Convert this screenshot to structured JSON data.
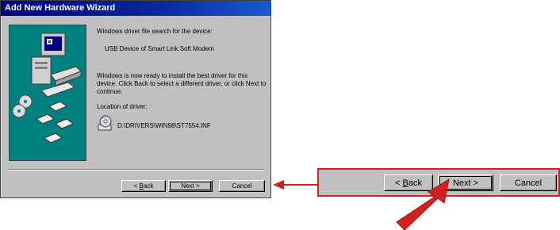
{
  "window": {
    "title": "Add New Hardware Wizard"
  },
  "content": {
    "search_label": "Windows driver file search for the device:",
    "device_name": "USB Device of Smart Link Soft Modem",
    "ready_text": "Windows is now ready to install the best driver for this device. Click Back to select a different driver, or click Next to continue.",
    "location_label": "Location of driver:",
    "driver_path": "D:\\DRIVERS\\WIN98\\ST7554.INF"
  },
  "buttons": {
    "back_prefix": "< ",
    "back_accel": "B",
    "back_rest": "ack",
    "next_label": "Next >",
    "cancel_label": "Cancel"
  },
  "icons": {
    "banner": "computer-with-disks-icon",
    "driver": "cd-driver-icon",
    "callout": "red-arrow-icon"
  },
  "colors": {
    "titlebar": "#00007b",
    "banner_bg": "#00807f",
    "dialog_bg": "#c0c0c0",
    "highlight": "#d02020"
  }
}
